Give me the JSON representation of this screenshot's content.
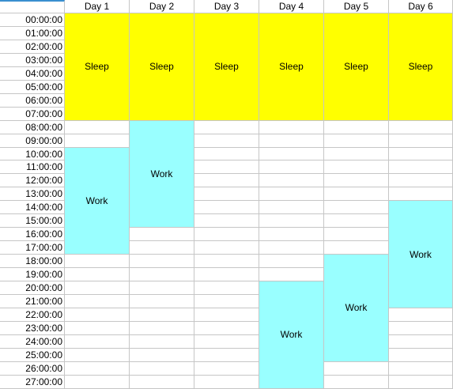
{
  "columns": [
    "Day 1",
    "Day 2",
    "Day 3",
    "Day 4",
    "Day 5",
    "Day 6"
  ],
  "rows": [
    "00:00:00",
    "01:00:00",
    "02:00:00",
    "03:00:00",
    "04:00:00",
    "05:00:00",
    "06:00:00",
    "07:00:00",
    "08:00:00",
    "09:00:00",
    "10:00:00",
    "11:00:00",
    "12:00:00",
    "13:00:00",
    "14:00:00",
    "15:00:00",
    "16:00:00",
    "17:00:00",
    "18:00:00",
    "19:00:00",
    "20:00:00",
    "21:00:00",
    "22:00:00",
    "23:00:00",
    "24:00:00",
    "25:00:00",
    "26:00:00",
    "27:00:00"
  ],
  "colors": {
    "sleep": "#ffff00",
    "work": "#99ffff"
  },
  "blocks": [
    {
      "day": 1,
      "start": 0,
      "end": 7,
      "label": "Sleep",
      "type": "sleep"
    },
    {
      "day": 2,
      "start": 0,
      "end": 7,
      "label": "Sleep",
      "type": "sleep"
    },
    {
      "day": 3,
      "start": 0,
      "end": 7,
      "label": "Sleep",
      "type": "sleep"
    },
    {
      "day": 4,
      "start": 0,
      "end": 7,
      "label": "Sleep",
      "type": "sleep"
    },
    {
      "day": 5,
      "start": 0,
      "end": 7,
      "label": "Sleep",
      "type": "sleep"
    },
    {
      "day": 6,
      "start": 0,
      "end": 7,
      "label": "Sleep",
      "type": "sleep"
    },
    {
      "day": 1,
      "start": 10,
      "end": 17,
      "label": "Work",
      "type": "work"
    },
    {
      "day": 2,
      "start": 8,
      "end": 15,
      "label": "Work",
      "type": "work"
    },
    {
      "day": 4,
      "start": 20,
      "end": 27,
      "label": "Work",
      "type": "work"
    },
    {
      "day": 5,
      "start": 18,
      "end": 25,
      "label": "Work",
      "type": "work"
    },
    {
      "day": 6,
      "start": 14,
      "end": 21,
      "label": "Work",
      "type": "work"
    }
  ]
}
